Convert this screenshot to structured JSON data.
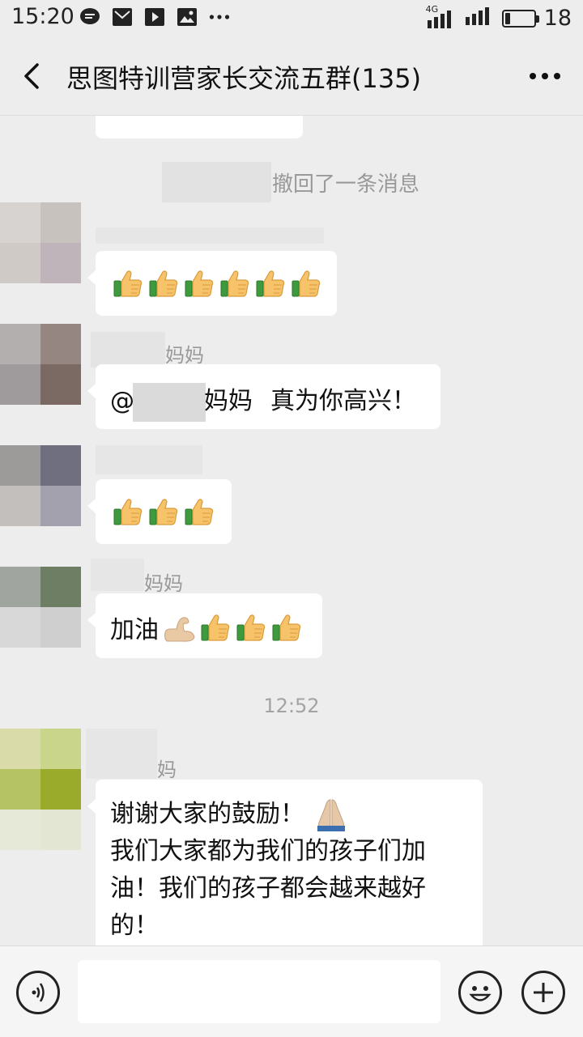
{
  "status": {
    "time": "15:20",
    "network": "4G",
    "battery": "18",
    "battery_level": 0.18
  },
  "header": {
    "title": "思图特训营家长交流五群(135)",
    "back_icon": "chevron-left-icon",
    "more_icon": "more-dots-icon"
  },
  "messages": {
    "recall_text": "撤回了一条消息",
    "m3_name_suffix": "妈妈",
    "m3_mention_at": "@",
    "m3_mention_tail": "妈妈",
    "m3_text": "真为你高兴！",
    "m5_name_suffix": "妈妈",
    "m5_text": "加油",
    "time_separator": "12:52",
    "m6_name_suffix": "妈",
    "m6_line1": "谢谢大家的鼓励！",
    "m6_line2": "我们大家都为我们的孩子们加",
    "m6_line3": "油！我们的孩子都会越来越好",
    "m6_line4": "的！"
  },
  "footer": {
    "voice_icon": "voice-icon",
    "emoji_icon": "smiley-icon",
    "plus_icon": "plus-icon"
  }
}
